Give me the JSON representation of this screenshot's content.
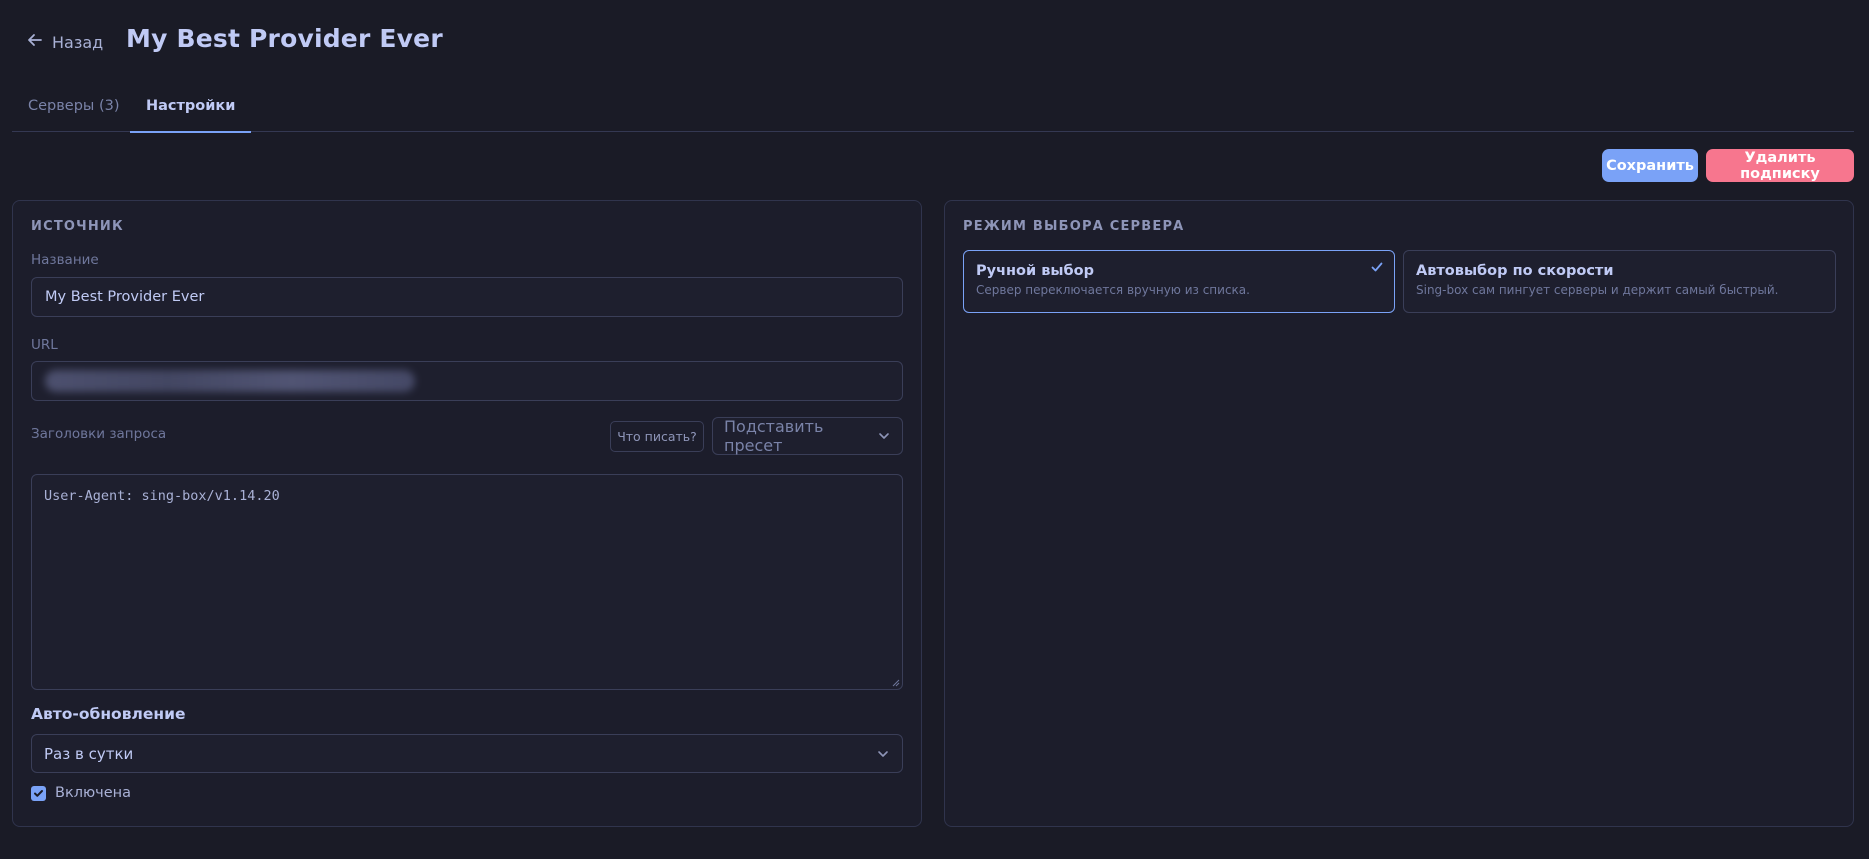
{
  "header": {
    "back_label": "Назад",
    "title": "My Best Provider Ever"
  },
  "tabs": [
    {
      "label": "Серверы (3)",
      "active": false
    },
    {
      "label": "Настройки",
      "active": true
    }
  ],
  "actions": {
    "save_label": "Сохранить",
    "delete_label": "Удалить подписку"
  },
  "source": {
    "section_title": "ИСТОЧНИК",
    "name_label": "Название",
    "name_value": "My Best Provider Ever",
    "url_label": "URL",
    "headers_label": "Заголовки запроса",
    "help_button": "Что писать?",
    "preset_placeholder": "Подставить пресет",
    "headers_value": "User-Agent: sing-box/v1.14.20",
    "auto_update_label": "Авто-обновление",
    "auto_update_value": "Раз в сутки",
    "enabled_label": "Включена",
    "enabled": true
  },
  "server_mode": {
    "section_title": "РЕЖИМ ВЫБОРА СЕРВЕРА",
    "options": [
      {
        "title": "Ручной выбор",
        "desc": "Сервер переключается вручную из списка.",
        "selected": true
      },
      {
        "title": "Автовыбор по скорости",
        "desc": "Sing-box сам пингует серверы и держит самый быстрый.",
        "selected": false
      }
    ]
  },
  "colors": {
    "background": "#1a1b26",
    "accent": "#7aa2f7",
    "danger": "#f7768e"
  },
  "icons": [
    "arrow-left-icon",
    "chevron-down-icon",
    "check-icon"
  ]
}
